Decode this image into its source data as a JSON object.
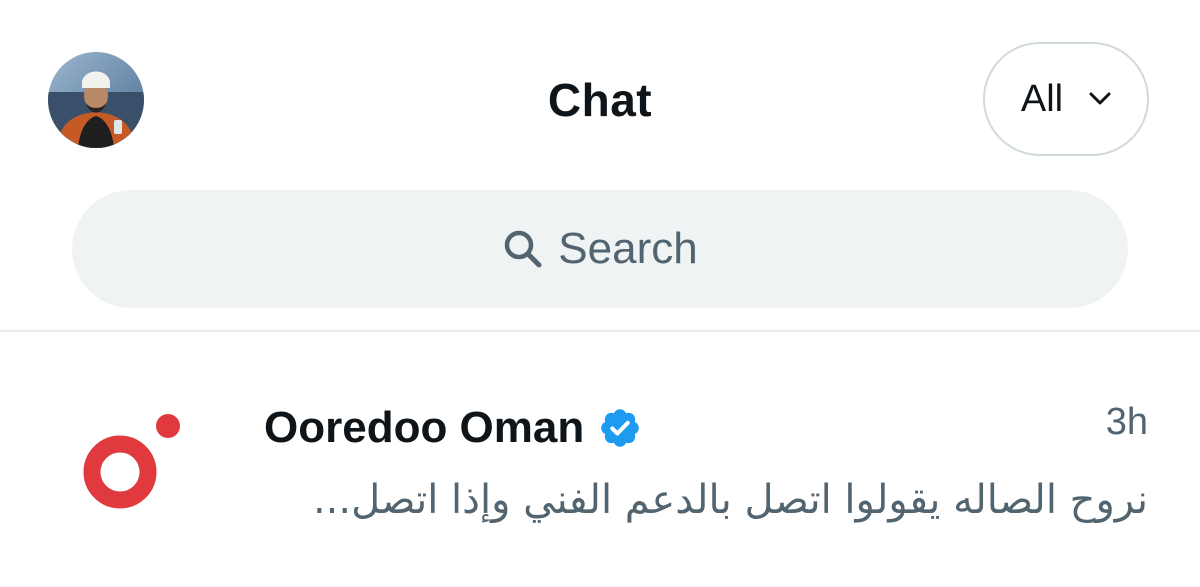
{
  "header": {
    "title": "Chat",
    "filter_label": "All",
    "avatar_icon": "profile-avatar-icon"
  },
  "search": {
    "placeholder": "Search",
    "icon": "search-icon"
  },
  "conversations": [
    {
      "name": "Ooredoo Oman",
      "verified": true,
      "time": "3h",
      "preview": "نروح الصاله يقولوا اتصل بالدعم الفني وإذا اتصل...",
      "logo_icon": "ooredoo-logo-icon"
    }
  ],
  "colors": {
    "text_primary": "#0f1419",
    "text_secondary": "#536471",
    "search_bg": "#eff3f4",
    "border": "#cfd9de",
    "verified_blue": "#1d9bf0",
    "ooredoo_red": "#e03a3e"
  }
}
